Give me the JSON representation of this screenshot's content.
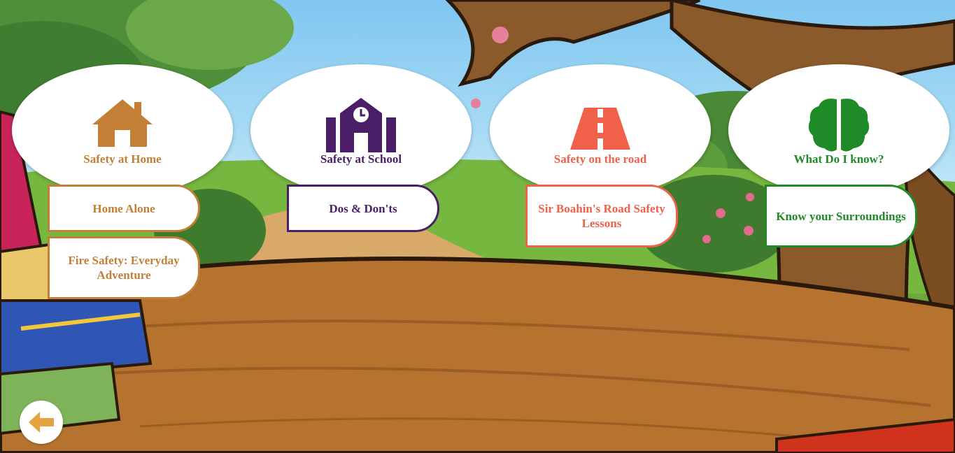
{
  "colors": {
    "home": "#c37f35",
    "school": "#4a1f67",
    "road": "#f0604a",
    "know": "#1f8a28"
  },
  "categories": [
    {
      "title": "Safety at Home",
      "icon": "house-icon",
      "buttons": [
        "Home Alone",
        "Fire Safety: Everyday Adventure"
      ]
    },
    {
      "title": "Safety at School",
      "icon": "school-building-icon",
      "buttons": [
        "Dos & Don'ts"
      ]
    },
    {
      "title": "Safety on the road",
      "icon": "road-icon",
      "buttons": [
        "Sir Boahin's Road Safety Lessons"
      ]
    },
    {
      "title": "What Do I know?",
      "icon": "brain-icon",
      "buttons": [
        "Know your Surroundings"
      ]
    }
  ],
  "back_icon": "back-arrow-icon"
}
